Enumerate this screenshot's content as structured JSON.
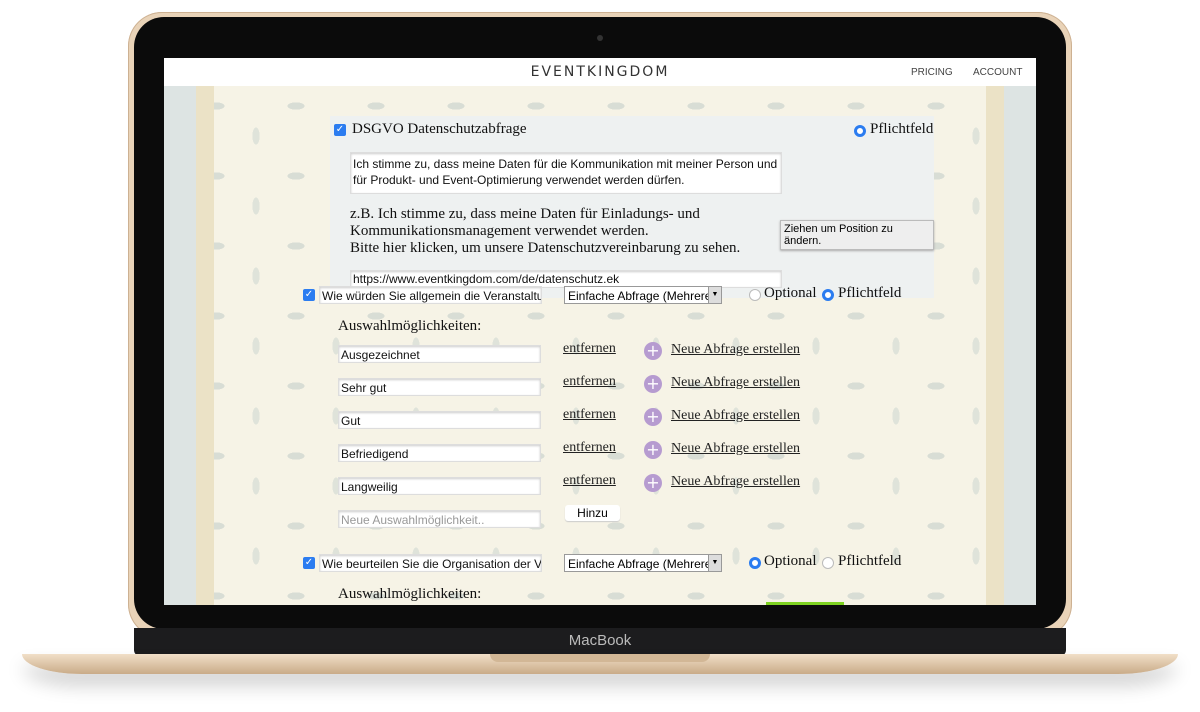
{
  "device_label": "MacBook",
  "header": {
    "logo": "EVENTKINGDOM",
    "nav": [
      "PRICING",
      "ACCOUNT"
    ]
  },
  "dsgvo": {
    "title": "DSGVO Datenschutzabfrage",
    "required_label": "Pflichtfeld",
    "text_value": "Ich stimme zu, dass meine Daten für die Kommunikation mit meiner Person und für Produkt- und Event-Optimierung verwendet werden dürfen.",
    "hint_lines": [
      "z.B. Ich stimme zu, dass meine Daten für Einladungs- und",
      "Kommunikationsmanagement verwendet werden.",
      "Bitte hier klicken, um unsere Datenschutzvereinbarung zu sehen."
    ],
    "url_value": "https://www.eventkingdom.com/de/datenschutz.ek",
    "tooltip": "Ziehen um Position zu ändern."
  },
  "q1": {
    "question": "Wie würden Sie allgemein die Veranstaltung",
    "type": "Einfache Abfrage (Mehrere",
    "optional_label": "Optional",
    "required_label": "Pflichtfeld",
    "selected": "Pflichtfeld",
    "options_label": "Auswahlmöglichkeiten:",
    "options": [
      "Ausgezeichnet",
      "Sehr gut",
      "Gut",
      "Befriedigend",
      "Langweilig"
    ],
    "remove_label": "entfernen",
    "new_query_label": "Neue Abfrage erstellen",
    "new_option_placeholder": "Neue Auswahlmöglichkeit..",
    "add_label": "Hinzu"
  },
  "q2": {
    "question": "Wie beurteilen Sie die Organisation der Veranstaltung",
    "type": "Einfache Abfrage (Mehrere",
    "optional_label": "Optional",
    "required_label": "Pflichtfeld",
    "selected": "Optional",
    "options_label": "Auswahlmöglichkeiten:"
  },
  "colors": {
    "accent": "#2b7cf0",
    "plus": "#b69bd0"
  }
}
